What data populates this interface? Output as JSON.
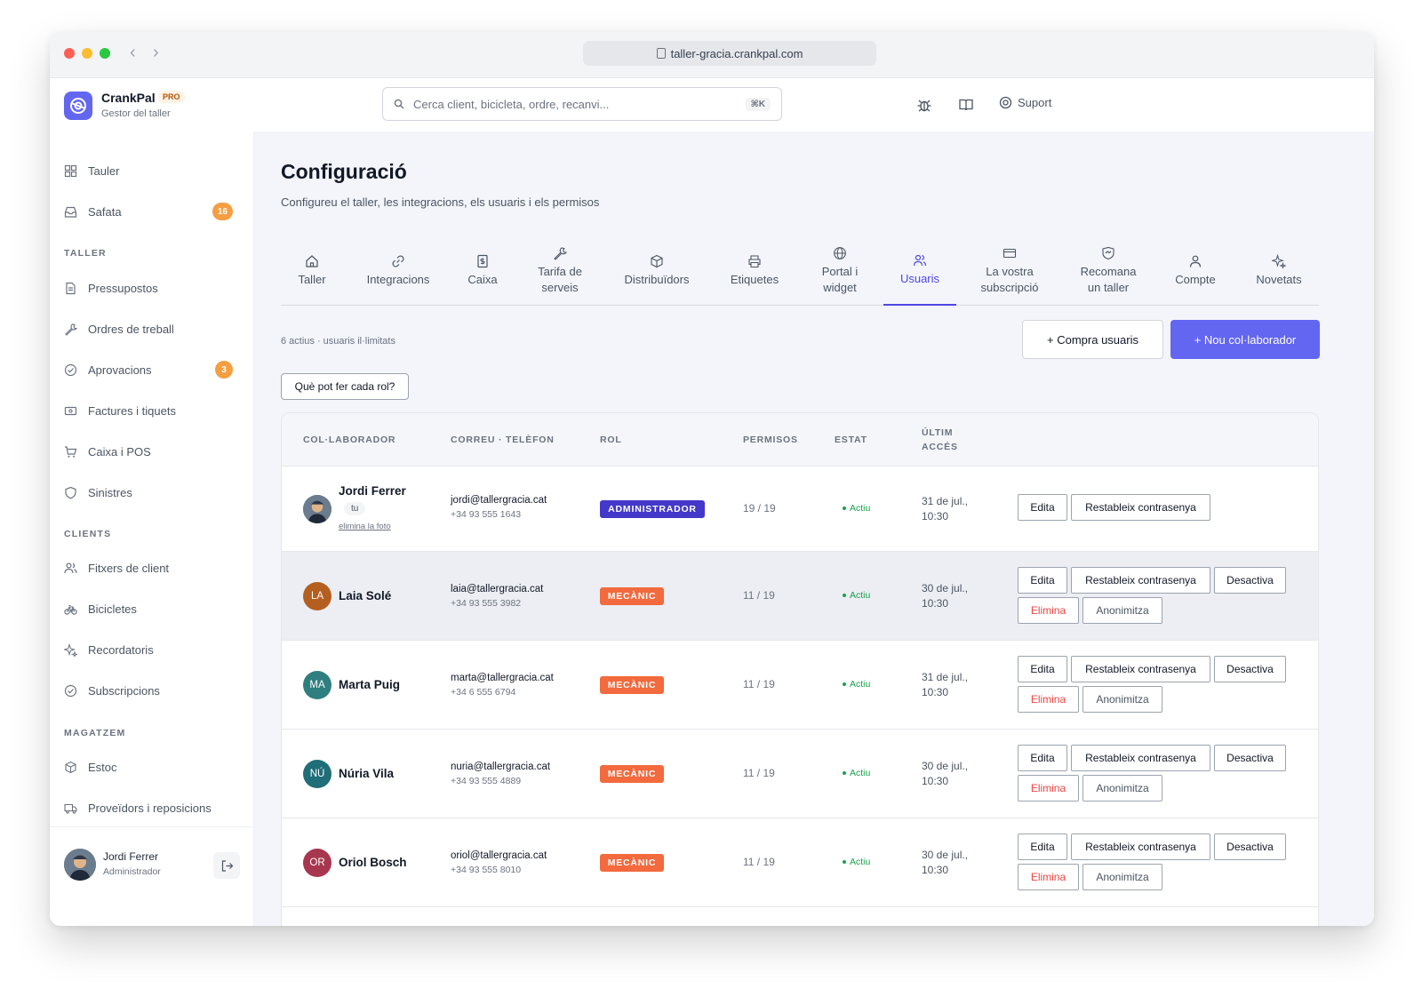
{
  "browser": {
    "url": "taller-gracia.crankpal.com"
  },
  "app": {
    "name": "CrankPal",
    "badge": "PRO",
    "subtitle": "Gestor del taller"
  },
  "search": {
    "placeholder": "Cerca client, bicicleta, ordre, recanvi...",
    "shortcut": "⌘K"
  },
  "header": {
    "support_label": "Suport"
  },
  "sidebar": {
    "top": [
      {
        "label": "Tauler",
        "icon": "grid-icon"
      },
      {
        "label": "Safata",
        "icon": "inbox-icon",
        "badge": "16"
      }
    ],
    "sections": [
      {
        "title": "TALLER",
        "items": [
          {
            "label": "Pressupostos",
            "icon": "document-icon"
          },
          {
            "label": "Ordres de treball",
            "icon": "wrench-icon"
          },
          {
            "label": "Aprovacions",
            "icon": "check-circle-icon",
            "badge": "3"
          },
          {
            "label": "Factures i tiquets",
            "icon": "receipt-icon"
          },
          {
            "label": "Caixa i POS",
            "icon": "cart-icon"
          },
          {
            "label": "Sinistres",
            "icon": "shield-icon"
          }
        ]
      },
      {
        "title": "CLIENTS",
        "items": [
          {
            "label": "Fitxers de client",
            "icon": "users-icon"
          },
          {
            "label": "Bicicletes",
            "icon": "bike-icon"
          },
          {
            "label": "Recordatoris",
            "icon": "sparkle-icon"
          },
          {
            "label": "Subscripcions",
            "icon": "check-circle-icon"
          }
        ]
      },
      {
        "title": "MAGATZEM",
        "items": [
          {
            "label": "Estoc",
            "icon": "box-icon"
          },
          {
            "label": "Proveïdors i reposicions",
            "icon": "truck-icon"
          }
        ]
      }
    ],
    "user": {
      "name": "Jordi Ferrer",
      "role": "Administrador"
    }
  },
  "page": {
    "title": "Configuració",
    "subtitle": "Configureu el taller, les integracions, els usuaris i els permisos",
    "tabs": [
      {
        "line1": "Taller",
        "line2": "",
        "icon": "home-icon"
      },
      {
        "line1": "Integracions",
        "line2": "",
        "icon": "link-icon"
      },
      {
        "line1": "Caixa",
        "line2": "",
        "icon": "cash-icon"
      },
      {
        "line1": "Tarifa de",
        "line2": "serveis",
        "icon": "wrench-icon"
      },
      {
        "line1": "Distribuïdors",
        "line2": "",
        "icon": "box-icon"
      },
      {
        "line1": "Etiquetes",
        "line2": "",
        "icon": "printer-icon"
      },
      {
        "line1": "Portal i",
        "line2": "widget",
        "icon": "globe-icon"
      },
      {
        "line1": "Usuaris",
        "line2": "",
        "icon": "users-icon",
        "active": true
      },
      {
        "line1": "La vostra",
        "line2": "subscripció",
        "icon": "card-icon"
      },
      {
        "line1": "Recomana",
        "line2": "un taller",
        "icon": "handshake-icon"
      },
      {
        "line1": "Compte",
        "line2": "",
        "icon": "user-icon"
      },
      {
        "line1": "Novetats",
        "line2": "",
        "icon": "sparkle-icon"
      }
    ],
    "users_summary": "6 actius · usuaris il·limitats",
    "buy_users_label": "+ Compra usuaris",
    "new_collab_label": "+ Nou col·laborador",
    "roles_help_label": "Què pot fer cada rol?"
  },
  "table": {
    "headers": [
      "COL·LABORADOR",
      "CORREU · TELÈFON",
      "ROL",
      "PERMISOS",
      "ESTAT",
      "ÚLTIM",
      "ACCÉS"
    ],
    "you_label": "tu",
    "remove_photo_label": "elimina la foto",
    "actions": {
      "edit": "Edita",
      "reset": "Restableix contrasenya",
      "deactivate": "Desactiva",
      "delete": "Elimina",
      "anonymize": "Anonimitza"
    },
    "rows": [
      {
        "initials": "",
        "name": "Jordi Ferrer",
        "email": "jordi@tallergracia.cat",
        "phone": "+34 93 555 1643",
        "role": "ADMINISTRADOR",
        "role_color": "#4338ca",
        "permissions": "19 / 19",
        "status": "Actiu",
        "last_date": "31 de jul.,",
        "last_time": "10:30",
        "is_self": true
      },
      {
        "initials": "LA",
        "avatar_color": "#b45f1f",
        "name": "Laia Solé",
        "email": "laia@tallergracia.cat",
        "phone": "+34 93 555 3982",
        "role": "MECÀNIC",
        "role_color": "#f26a3d",
        "permissions": "11 / 19",
        "status": "Actiu",
        "last_date": "30 de jul.,",
        "last_time": "10:30"
      },
      {
        "initials": "MA",
        "avatar_color": "#2f7f80",
        "name": "Marta Puig",
        "email": "marta@tallergracia.cat",
        "phone": "+34 6 555 6794",
        "role": "MECÀNIC",
        "role_color": "#f26a3d",
        "permissions": "11 / 19",
        "status": "Actiu",
        "last_date": "31 de jul.,",
        "last_time": "10:30"
      },
      {
        "initials": "NÚ",
        "avatar_color": "#1f6e78",
        "name": "Núria Vila",
        "email": "nuria@tallergracia.cat",
        "phone": "+34 93 555 4889",
        "role": "MECÀNIC",
        "role_color": "#f26a3d",
        "permissions": "11 / 19",
        "status": "Actiu",
        "last_date": "30 de jul.,",
        "last_time": "10:30"
      },
      {
        "initials": "OR",
        "avatar_color": "#a8364f",
        "name": "Oriol Bosch",
        "email": "oriol@tallergracia.cat",
        "phone": "+34 93 555 8010",
        "role": "MECÀNIC",
        "role_color": "#f26a3d",
        "permissions": "11 / 19",
        "status": "Actiu",
        "last_date": "30 de jul.,",
        "last_time": "10:30"
      }
    ]
  },
  "colors": {
    "accent": "#6366f1",
    "badge": "#f59e42",
    "active_status": "#16a34a",
    "danger": "#ef4444"
  }
}
